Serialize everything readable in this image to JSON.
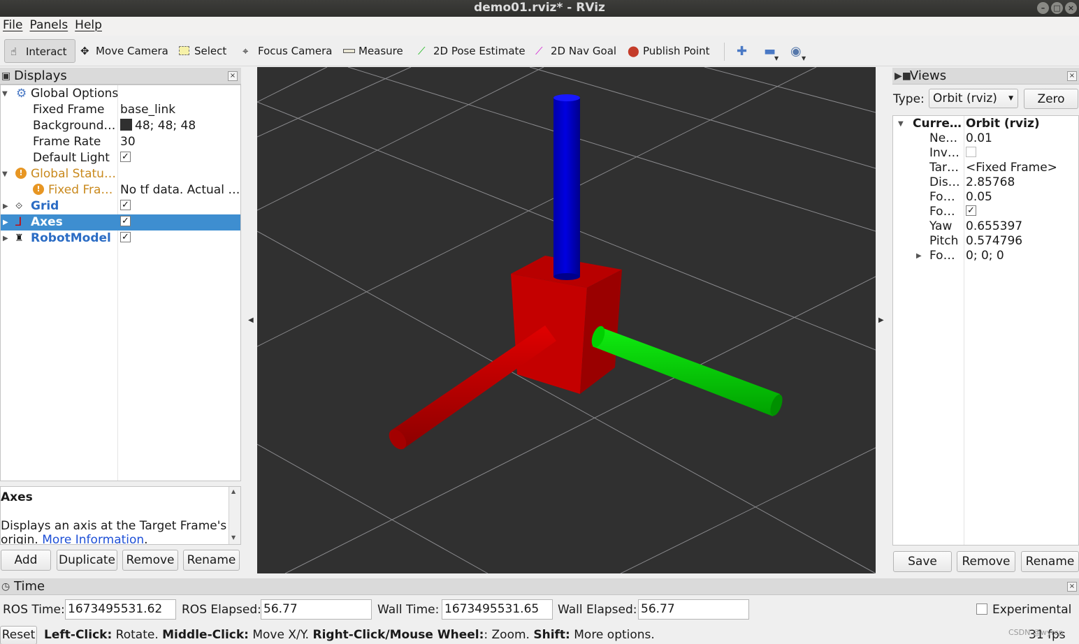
{
  "window": {
    "title": "demo01.rviz* - RViz"
  },
  "menu": [
    "File",
    "Panels",
    "Help"
  ],
  "toolbar": {
    "tools": [
      {
        "label": "Interact",
        "icon": "hand-icon"
      },
      {
        "label": "Move Camera",
        "icon": "move-camera-icon"
      },
      {
        "label": "Select",
        "icon": "select-icon"
      },
      {
        "label": "Focus Camera",
        "icon": "focus-camera-icon"
      },
      {
        "label": "Measure",
        "icon": "measure-icon"
      },
      {
        "label": "2D Pose Estimate",
        "icon": "pose-estimate-icon"
      },
      {
        "label": "2D Nav Goal",
        "icon": "nav-goal-icon"
      },
      {
        "label": "Publish Point",
        "icon": "publish-point-icon"
      }
    ],
    "active_tool": "Interact"
  },
  "displays": {
    "title": "Displays",
    "global_options": {
      "label": "Global Options",
      "fixed_frame_label": "Fixed Frame",
      "fixed_frame_value": "base_link",
      "background_label": "Background…",
      "background_value": "48; 48; 48",
      "background_color": "#303030",
      "frame_rate_label": "Frame Rate",
      "frame_rate_value": "30",
      "default_light_label": "Default Light",
      "default_light_checked": "✓"
    },
    "global_status": {
      "label": "Global Statu…",
      "fixed_frame_label": "Fixed Fra…",
      "fixed_frame_value": "No tf data.  Actual …"
    },
    "items": [
      {
        "label": "Grid",
        "checked": "✓"
      },
      {
        "label": "Axes",
        "checked": "✓"
      },
      {
        "label": "RobotModel",
        "checked": "✓"
      }
    ],
    "selected": "Axes",
    "description": {
      "title": "Axes",
      "text": "Displays an axis at the Target Frame's origin. ",
      "link": "More Information"
    },
    "buttons": [
      "Add",
      "Duplicate",
      "Remove",
      "Rename"
    ]
  },
  "views": {
    "title": "Views",
    "type_label": "Type:",
    "type_value": "Orbit (rviz)",
    "zero_label": "Zero",
    "current_label": "Curre…",
    "current_value": "Orbit (rviz)",
    "props": [
      {
        "key": "Ne…",
        "value": "0.01"
      },
      {
        "key": "Inv…",
        "value": ""
      },
      {
        "key": "Tar…",
        "value": "<Fixed Frame>"
      },
      {
        "key": "Dis…",
        "value": "2.85768"
      },
      {
        "key": "Fo…",
        "value": "0.05"
      },
      {
        "key": "Fo…",
        "value": "✓"
      },
      {
        "key": "Yaw",
        "value": "0.655397"
      },
      {
        "key": "Pitch",
        "value": "0.574796"
      },
      {
        "key": "Fo…",
        "value": "0; 0; 0"
      }
    ],
    "buttons": [
      "Save",
      "Remove",
      "Rename"
    ]
  },
  "time": {
    "title": "Time",
    "ros_time_label": "ROS Time:",
    "ros_time_value": "1673495531.62",
    "ros_elapsed_label": "ROS Elapsed:",
    "ros_elapsed_value": "56.77",
    "wall_time_label": "Wall Time:",
    "wall_time_value": "1673495531.65",
    "wall_elapsed_label": "Wall Elapsed:",
    "wall_elapsed_value": "56.77",
    "experimental_label": "Experimental"
  },
  "status": {
    "reset_label": "Reset",
    "h1": "Left-Click:",
    "t1": " Rotate. ",
    "h2": "Middle-Click:",
    "t2": " Move X/Y. ",
    "h3": "Right-Click/Mouse Wheel:",
    "t3": ": Zoom. ",
    "h4": "Shift:",
    "t4": " More options.",
    "fps": "31 fps",
    "watermark": "CSDN @wyrcp"
  },
  "colors": {
    "x_axis": "#c00000",
    "y_axis": "#00c000",
    "z_axis": "#0000cc",
    "grid": "#a0a0a4",
    "selection": "#3e8ed0"
  }
}
